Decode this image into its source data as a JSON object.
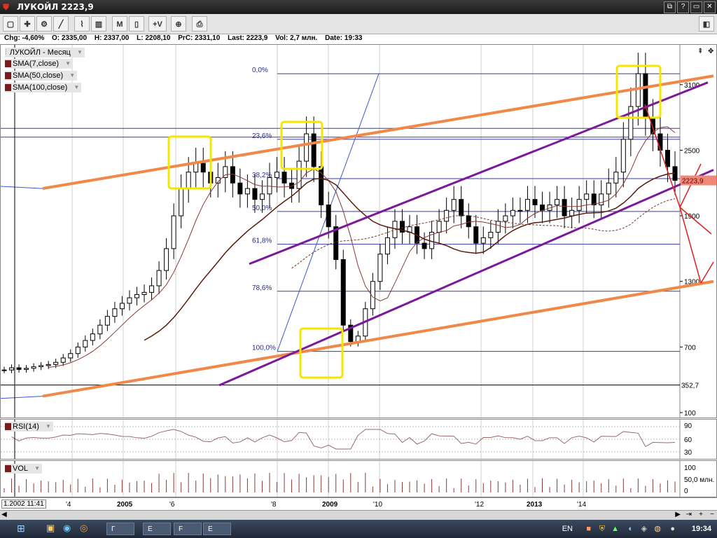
{
  "window": {
    "title": "ЛУКОЙЛ 2223,9",
    "buttons": [
      "⧉",
      "?",
      "▭",
      "✕"
    ]
  },
  "toolbar": {
    "buttons": [
      {
        "name": "timeframe-button",
        "label": "M"
      },
      {
        "name": "add-indicator-button",
        "label": "+V"
      }
    ]
  },
  "quote": {
    "chg": "Chg: -4,60%",
    "o": "O: 2335,00",
    "h": "H: 2337,00",
    "l": "L: 2208,10",
    "prc": "PrC: 2331,10",
    "last": "Last: 2223,9",
    "vol": "Vol: 2,7 млн.",
    "date": "Date: 19:33"
  },
  "legend": [
    {
      "label": "ЛУКОЙЛ - Месяц"
    },
    {
      "label": "SMA(7,close)"
    },
    {
      "label": "SMA(50,close)"
    },
    {
      "label": "SMA(100,close)"
    }
  ],
  "rsi_panel": {
    "label": "RSI(14)",
    "ticks": [
      "90",
      "60",
      "30"
    ]
  },
  "vol_panel": {
    "label": "VOL",
    "ticks": [
      "100",
      "50,0 млн.",
      "0"
    ]
  },
  "last_price_label": "2223,9",
  "min_label": "352,7",
  "cursor_date": "1.2002 11:41",
  "taskbar": {
    "tasks": [
      "Г",
      "Е",
      "F",
      "Е"
    ],
    "lang": "EN",
    "clock": "19:34"
  },
  "chart_data": {
    "type": "candlestick",
    "title": "ЛУКОЙЛ - Месяц",
    "x_ticks": [
      "'4",
      "2005",
      "'6",
      "'8",
      "2009",
      "'10",
      "'12",
      "2013",
      "'14"
    ],
    "y_ticks": [
      3100,
      2500,
      1900,
      1300,
      700,
      100
    ],
    "ylim": [
      100,
      3400
    ],
    "fibonacci_levels": [
      {
        "label": "0,0%",
        "value": 3200
      },
      {
        "label": "23,6%",
        "value": 2600
      },
      {
        "label": "38,2%",
        "value": 2240
      },
      {
        "label": "50,0%",
        "value": 1940
      },
      {
        "label": "61,8%",
        "value": 1640
      },
      {
        "label": "78,6%",
        "value": 1210
      },
      {
        "label": "100,0%",
        "value": 660
      }
    ],
    "close_series": [
      490,
      510,
      495,
      505,
      520,
      530,
      540,
      560,
      600,
      640,
      700,
      760,
      820,
      900,
      980,
      1050,
      1100,
      1150,
      1180,
      1200,
      1260,
      1400,
      1600,
      1900,
      2150,
      2300,
      2380,
      2300,
      2200,
      2250,
      2350,
      2200,
      2100,
      2150,
      2050,
      2100,
      2250,
      2300,
      2200,
      2150,
      2400,
      2650,
      2350,
      2000,
      1800,
      1500,
      900,
      750,
      800,
      1050,
      1300,
      1550,
      1700,
      1850,
      1750,
      1800,
      1650,
      1600,
      1750,
      1850,
      1950,
      2050,
      1900,
      1800,
      1650,
      1700,
      1750,
      1850,
      1900,
      1950,
      1950,
      2050,
      2000,
      1950,
      2000,
      2050,
      1900,
      1950,
      2050,
      2100,
      2000,
      2100,
      2200,
      2300,
      2600,
      2900,
      3200,
      2800,
      2650,
      2500,
      2350,
      2223.9
    ],
    "current_price": 2223.9,
    "min_value": 352.7,
    "rsi_ticks": [
      90,
      60,
      30
    ],
    "vol_ticks": [
      "100",
      "50,0 млн.",
      "0"
    ]
  }
}
